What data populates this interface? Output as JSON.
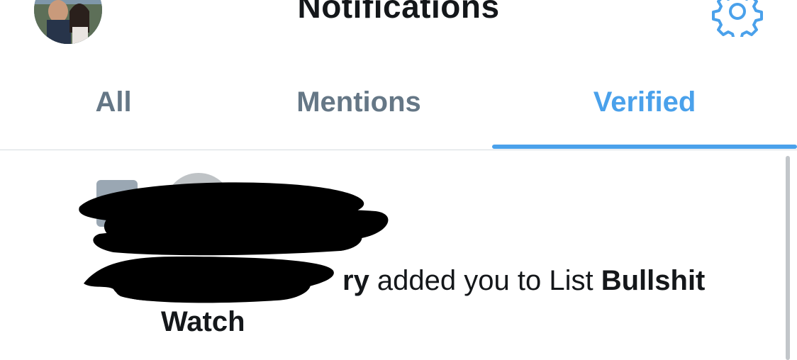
{
  "header": {
    "title": "Notifications",
    "avatar_icon": "profile-photo",
    "settings_icon": "gear-icon"
  },
  "tabs": [
    {
      "label": "All",
      "active": false
    },
    {
      "label": "Mentions",
      "active": false
    },
    {
      "label": "Verified",
      "active": true
    }
  ],
  "colors": {
    "accent": "#4aa1eb",
    "tab_inactive": "#657786",
    "text": "#14171a",
    "divider": "#d6dbe0"
  },
  "notification": {
    "icon": "list-icon",
    "user_fragment": "ry",
    "action_text": " added you to List ",
    "list_name_part1": "Bullshit",
    "list_name_part2": "Watch"
  }
}
